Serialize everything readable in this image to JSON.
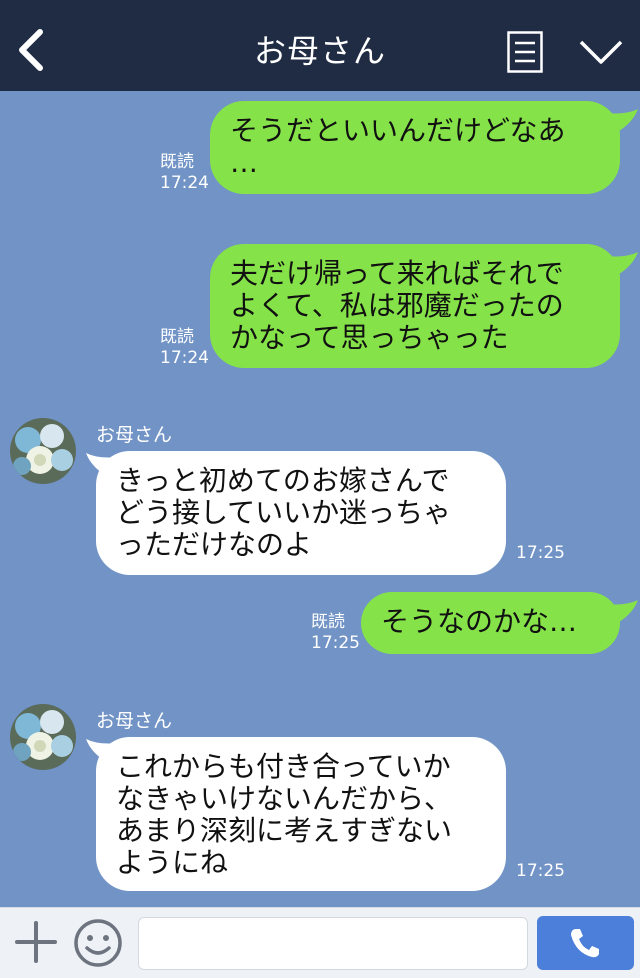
{
  "header": {
    "title": "お母さん",
    "back_icon": "back-chevron-icon",
    "menu_icon": "menu-list-icon",
    "collapse_icon": "chevron-down-icon"
  },
  "messages": [
    {
      "side": "out",
      "text": "そうだといいんだけどなあ\n…",
      "read_label": "既読",
      "time": "17:24"
    },
    {
      "side": "out",
      "text": "夫だけ帰って来ればそれで\nよくて、私は邪魔だったの\nかなって思っちゃった",
      "read_label": "既読",
      "time": "17:24"
    },
    {
      "side": "in",
      "sender": "お母さん",
      "text": "きっと初めてのお嫁さんで\nどう接していいか迷っちゃ\nっただけなのよ",
      "time": "17:25"
    },
    {
      "side": "out",
      "text": "そうなのかな…",
      "read_label": "既読",
      "time": "17:25"
    },
    {
      "side": "in",
      "sender": "お母さん",
      "text": "これからも付き合っていか\nなきゃいけないんだから、\nあまり深刻に考えすぎない\nようにね",
      "time": "17:25"
    }
  ],
  "input_bar": {
    "placeholder": "",
    "plus_icon": "plus-icon",
    "emoji_icon": "emoji-icon",
    "call_icon": "phone-icon"
  },
  "colors": {
    "header_bg": "#1f2c44",
    "chat_bg": "#7193c6",
    "outgoing_bubble": "#85e249",
    "incoming_bubble": "#ffffff",
    "call_button": "#4b7fd9"
  }
}
